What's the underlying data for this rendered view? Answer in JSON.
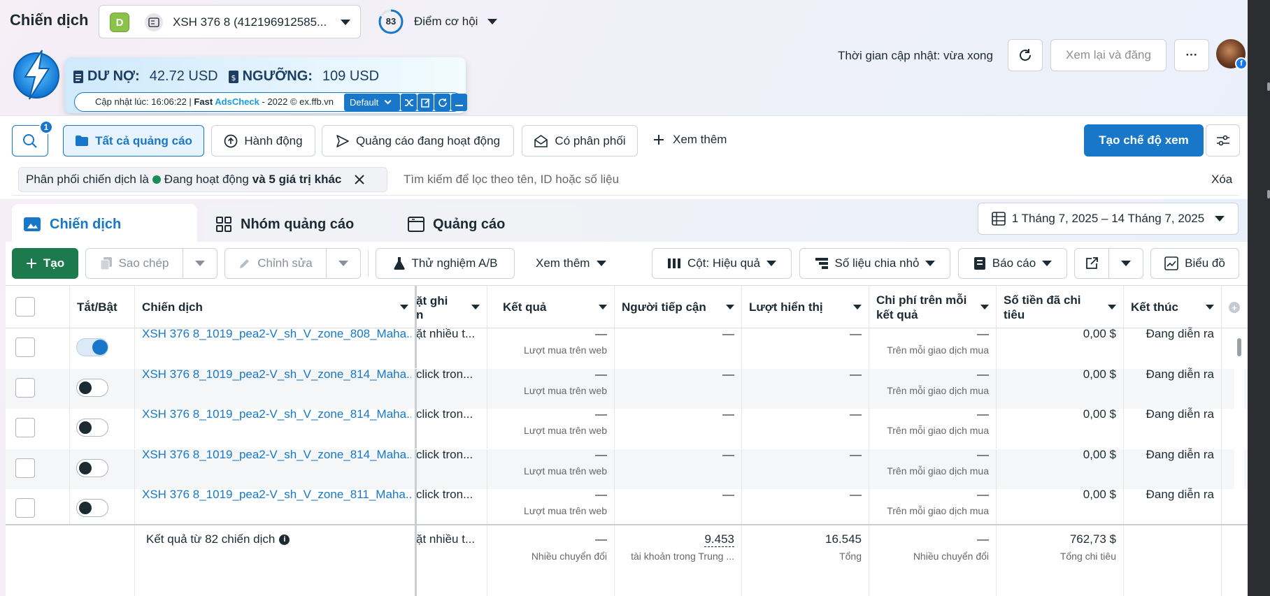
{
  "header": {
    "title": "Chiến dịch",
    "account_badge": "D",
    "account_name": "XSH 376 8 (412196912585...",
    "opportunity_score": "83",
    "opportunity_label": "Điểm cơ hội",
    "update_time": "Thời gian cập nhật: vừa xong",
    "review_button": "Xem lại và đăng",
    "more_button": "···"
  },
  "extension": {
    "debt_label": "DƯ NỢ:",
    "debt_value": "42.72 USD",
    "threshold_label": "NGƯỠNG:",
    "threshold_value": "109 USD",
    "updated_prefix": "Cập nhật lúc: 16:06:22 | ",
    "brand_fast": "Fast ",
    "brand_ads": "AdsCheck",
    "copyright": " - 2022 © ex.ffb.vn",
    "mode": "Default"
  },
  "filters": {
    "search_badge": "1",
    "all_ads": "Tất cả quảng cáo",
    "actions": "Hành động",
    "active_ads": "Quảng cáo đang hoạt động",
    "has_delivery": "Có phân phối",
    "see_more": "Xem thêm",
    "create_view": "Tạo chế độ xem"
  },
  "filter_bar": {
    "chip_prefix": "Phân phối chiến dịch là",
    "chip_status": "Đang hoạt động",
    "chip_suffix": "và 5 giá trị khác",
    "search_placeholder": "Tìm kiếm để lọc theo tên, ID hoặc số liệu",
    "clear": "Xóa"
  },
  "tabs": {
    "campaigns": "Chiến dịch",
    "ad_sets": "Nhóm quảng cáo",
    "ads": "Quảng cáo",
    "date_range": "1 Tháng 7, 2025 – 14 Tháng 7, 2025"
  },
  "toolbar": {
    "create": "Tạo",
    "duplicate": "Sao chép",
    "edit": "Chỉnh sửa",
    "ab_test": "Thử nghiệm A/B",
    "more": "Xem thêm",
    "columns": "Cột: Hiệu quả",
    "breakdown": "Số liệu chia nhỏ",
    "reports": "Báo cáo",
    "charts": "Biểu đồ"
  },
  "table": {
    "headers": {
      "toggle": "Tắt/Bật",
      "campaign": "Chiến dịch",
      "bid_a": "ặt ghi",
      "bid_b": "n",
      "results": "Kết quả",
      "reach": "Người tiếp cận",
      "impressions": "Lượt hiển thị",
      "cost_a": "Chi phí trên mỗi",
      "cost_b": "kết quả",
      "spent_a": "Số tiền đã chi",
      "spent_b": "tiêu",
      "end": "Kết thúc"
    },
    "rows": [
      {
        "name": "XSH 376 8_1019_pea2-V_sh_V_zone_808_Maha...",
        "bid": "ặt nhiều t...",
        "results": "—",
        "results_sub": "Lượt mua trên web",
        "reach": "—",
        "impressions": "—",
        "cost": "—",
        "cost_sub": "Trên mỗi giao dịch mua",
        "spent": "0,00 $",
        "end": "Đang diễn ra"
      },
      {
        "name": "XSH 376 8_1019_pea2-V_sh_V_zone_814_Maha...",
        "bid": "click tron...",
        "results": "—",
        "results_sub": "Lượt mua trên web",
        "reach": "—",
        "impressions": "—",
        "cost": "—",
        "cost_sub": "Trên mỗi giao dịch mua",
        "spent": "0,00 $",
        "end": "Đang diễn ra"
      },
      {
        "name": "XSH 376 8_1019_pea2-V_sh_V_zone_814_Maha...",
        "bid": "click tron...",
        "results": "—",
        "results_sub": "Lượt mua trên web",
        "reach": "—",
        "impressions": "—",
        "cost": "—",
        "cost_sub": "Trên mỗi giao dịch mua",
        "spent": "0,00 $",
        "end": "Đang diễn ra"
      },
      {
        "name": "XSH 376 8_1019_pea2-V_sh_V_zone_814_Maha...",
        "bid": "click tron...",
        "results": "—",
        "results_sub": "Lượt mua trên web",
        "reach": "—",
        "impressions": "—",
        "cost": "—",
        "cost_sub": "Trên mỗi giao dịch mua",
        "spent": "0,00 $",
        "end": "Đang diễn ra"
      },
      {
        "name": "XSH 376 8_1019_pea2-V_sh_V_zone_811_Maha...",
        "bid": "click tron...",
        "results": "—",
        "results_sub": "Lượt mua trên web",
        "reach": "—",
        "impressions": "—",
        "cost": "—",
        "cost_sub": "Trên mỗi giao dịch mua",
        "spent": "0,00 $",
        "end": "Đang diễn ra"
      }
    ],
    "summary": {
      "label": "Kết quả từ 82 chiến dịch",
      "bid": "ặt nhiều t...",
      "results": "—",
      "results_sub": "Nhiều chuyển đổi",
      "reach": "9.453",
      "reach_sub": "tài khoản trong Trung ...",
      "impressions": "16.545",
      "impressions_sub": "Tổng",
      "cost": "—",
      "cost_sub": "Nhiều chuyển đổi",
      "spent": "762,73 $",
      "spent_sub": "Tổng chi tiêu"
    }
  },
  "colors": {
    "primary": "#1877c9",
    "create": "#1c7a4c",
    "toggle_on": "#1877c9",
    "status_green": "#1c8a5a"
  }
}
